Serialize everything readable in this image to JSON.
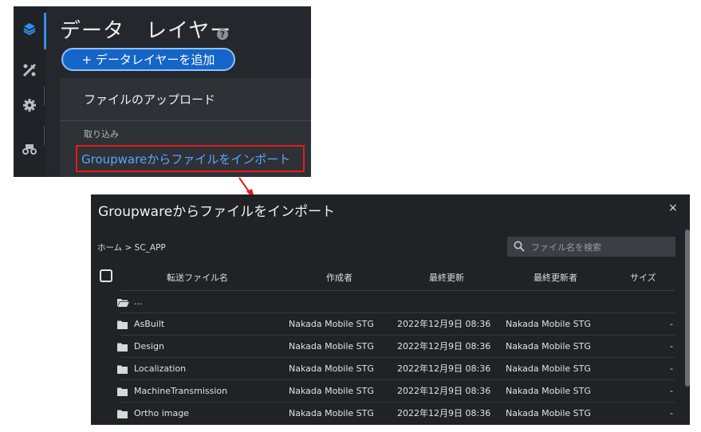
{
  "sidebar": {
    "icons": [
      "layers-icon",
      "survey-tools-icon",
      "settings-gear-icon",
      "machine-icon"
    ]
  },
  "layer_panel": {
    "title": "データ　レイヤー",
    "help_glyph": "?",
    "add_layer_label": "+ データレイヤーを追加"
  },
  "dropdown": {
    "upload_label": "ファイルのアップロード",
    "section_label": "取り込み",
    "import_label": "Groupwareからファイルをインポート"
  },
  "dialog": {
    "title": "Groupwareからファイルをインポート",
    "close_glyph": "×",
    "breadcrumb": "ホーム > SC_APP",
    "search_placeholder": "ファイル名を検索",
    "columns": {
      "name": "転送ファイル名",
      "creator": "作成者",
      "modified": "最終更新",
      "modified_by": "最終更新者",
      "size": "サイズ"
    },
    "parent_label": "...",
    "rows": [
      {
        "name": "AsBuilt",
        "creator": "Nakada Mobile STG",
        "modified": "2022年12月9日 08:36",
        "modified_by": "Nakada Mobile STG",
        "size": "-"
      },
      {
        "name": "Design",
        "creator": "Nakada Mobile STG",
        "modified": "2022年12月9日 08:36",
        "modified_by": "Nakada Mobile STG",
        "size": "-"
      },
      {
        "name": "Localization",
        "creator": "Nakada Mobile STG",
        "modified": "2022年12月9日 08:36",
        "modified_by": "Nakada Mobile STG",
        "size": "-"
      },
      {
        "name": "MachineTransmission",
        "creator": "Nakada Mobile STG",
        "modified": "2022年12月9日 08:36",
        "modified_by": "Nakada Mobile STG",
        "size": "-"
      },
      {
        "name": "Ortho image",
        "creator": "Nakada Mobile STG",
        "modified": "2022年12月9日 08:36",
        "modified_by": "Nakada Mobile STG",
        "size": "-"
      }
    ]
  },
  "colors": {
    "accent_blue": "#1565c8",
    "link_blue": "#5aa6ff",
    "highlight_red": "#e31b1b",
    "dialog_bg": "#202226",
    "panel_bg": "#24272b"
  }
}
